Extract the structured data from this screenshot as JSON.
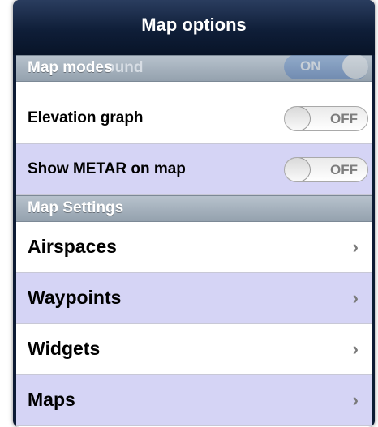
{
  "popover": {
    "title": "Map options"
  },
  "sections": {
    "map_modes": {
      "header": "Map modes",
      "ghost_text": "ound",
      "ghost_toggle": "ON"
    },
    "map_settings": {
      "header": "Map Settings"
    }
  },
  "toggles": [
    {
      "label": "Elevation graph",
      "state": "OFF"
    },
    {
      "label": "Show METAR on map",
      "state": "OFF"
    }
  ],
  "nav_items": [
    {
      "label": "Airspaces",
      "chevron": "›"
    },
    {
      "label": "Waypoints",
      "chevron": "›"
    },
    {
      "label": "Widgets",
      "chevron": "›"
    },
    {
      "label": "Maps",
      "chevron": "›"
    }
  ],
  "colors": {
    "title_bar": "#0f1e38",
    "row_highlight": "#d5d4f5",
    "section_header": "#a5b1bd"
  }
}
